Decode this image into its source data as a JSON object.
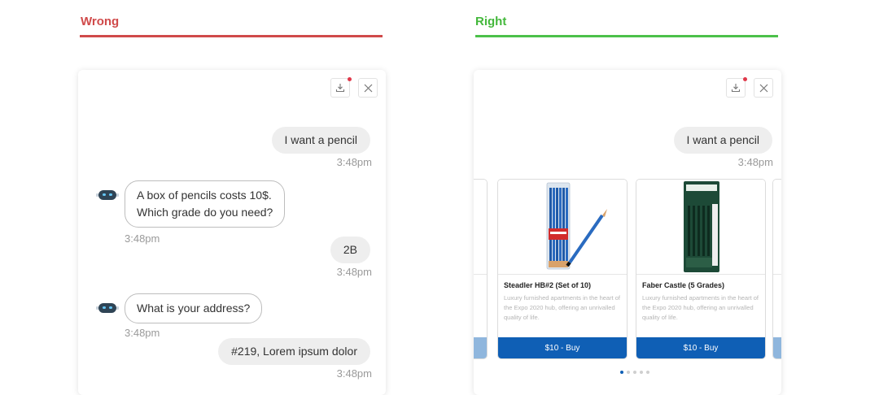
{
  "left": {
    "heading": "Wrong",
    "messages": [
      {
        "from": "user",
        "text": "I want a pencil",
        "time": "3:48pm"
      },
      {
        "from": "bot",
        "lines": [
          "A box of pencils costs 10$.",
          "Which grade do you need?"
        ],
        "time": "3:48pm"
      },
      {
        "from": "user",
        "text": "2B",
        "time": "3:48pm"
      },
      {
        "from": "bot",
        "lines": [
          "What is your address?"
        ],
        "time": "3:48pm"
      },
      {
        "from": "user",
        "text": "#219, Lorem ipsum dolor",
        "time": "3:48pm"
      }
    ]
  },
  "right": {
    "heading": "Right",
    "messages": [
      {
        "from": "user",
        "text": "I want a pencil",
        "time": "3:48pm"
      }
    ],
    "products": [
      {
        "title": "Steadler HB#2 (Set of 10)",
        "description": "Luxury furnished apartments in the heart of the Expo 2020 hub, offering an unrivalled quality of life.",
        "button": "$10 - Buy"
      },
      {
        "title": "Faber Castle (5 Grades)",
        "description": "Luxury furnished apartments in the heart of the Expo 2020 hub, offering an unrivalled quality of life.",
        "button": "$10 - Buy"
      }
    ],
    "carousel_pages": 5,
    "carousel_active_page": 1
  },
  "toolbar": {
    "download_icon": "download-icon",
    "close_icon": "close-icon"
  },
  "colors": {
    "wrong": "#d04a4a",
    "right": "#44b83c",
    "buy_button": "#0f5fb5",
    "notification": "#e0384a"
  }
}
